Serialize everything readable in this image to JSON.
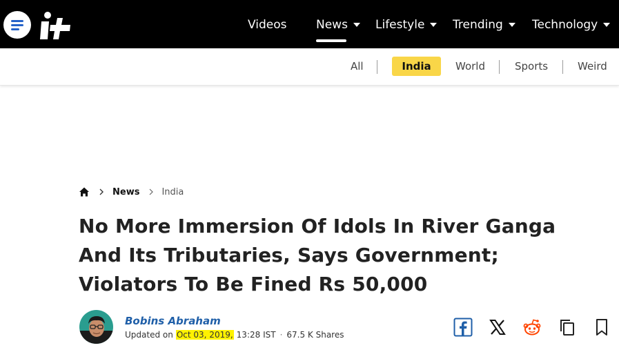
{
  "header": {
    "nav": [
      {
        "label": "Videos"
      },
      {
        "label": "News"
      },
      {
        "label": "Lifestyle"
      },
      {
        "label": "Trending"
      },
      {
        "label": "Technology"
      }
    ],
    "active_nav": "News"
  },
  "subnav": {
    "items": [
      "All",
      "India",
      "World",
      "Sports",
      "Weird"
    ],
    "active": "India"
  },
  "breadcrumb": {
    "section": "News",
    "current": "India"
  },
  "article": {
    "headline_lines": [
      "No More Immersion Of Idols In River Ganga",
      "And Its Tributaries, Says Government;",
      "Violators To Be Fined Rs 50,000"
    ],
    "author": "Bobins Abraham",
    "updated_prefix": "Updated on",
    "date": "Oct 03, 2019,",
    "time": "13:28 IST",
    "separator": "·",
    "shares": "67.5 K Shares"
  },
  "share_icons": [
    "facebook-icon",
    "x-icon",
    "reddit-icon",
    "copy-icon",
    "bookmark-icon"
  ],
  "colors": {
    "topbar": "#000000",
    "active_tab": "#f9d648",
    "author_link": "#1f5fa8",
    "highlight": "#fff200",
    "facebook": "#1f5fa8",
    "reddit": "#ff4500"
  }
}
